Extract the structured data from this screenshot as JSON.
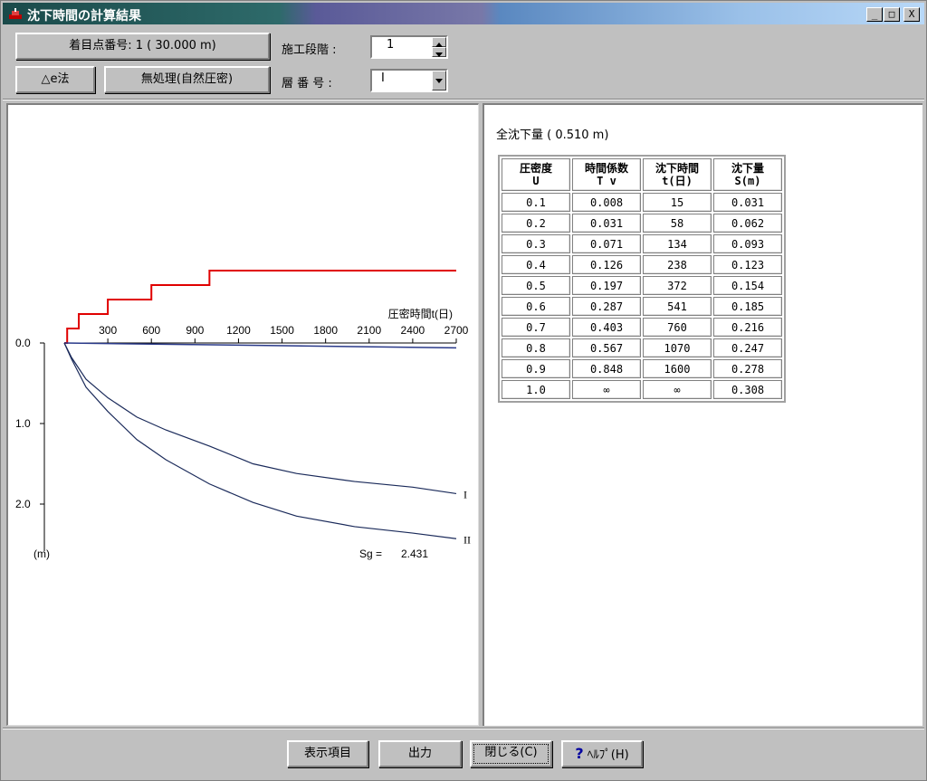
{
  "window": {
    "title": "沈下時間の計算結果",
    "minimize": "_",
    "maximize": "□",
    "close": "X"
  },
  "header": {
    "point_button": "着目点番号: 1 ( 30.000 m)",
    "method_button": "△e法",
    "treatment_button": "無処理(自然圧密)",
    "stage_label": "施工段階 :",
    "stage_value": "1",
    "layer_label": "層 番 号 :",
    "layer_value": "I"
  },
  "chart_data": {
    "type": "line",
    "xlabel": "圧密時間t(日)",
    "ylabel": "(m)",
    "xlim": [
      0,
      2700
    ],
    "ylim": [
      0,
      2.5
    ],
    "x_ticks": [
      "300",
      "600",
      "900",
      "1200",
      "1500",
      "1800",
      "2100",
      "2400",
      "2700"
    ],
    "y_ticks": [
      "0.0",
      "1.0",
      "2.0"
    ],
    "series": [
      {
        "name": "I",
        "x": [
          0,
          50,
          150,
          300,
          500,
          700,
          1000,
          1300,
          1600,
          2000,
          2400,
          2700
        ],
        "y": [
          0,
          0.18,
          0.45,
          0.68,
          0.92,
          1.08,
          1.28,
          1.5,
          1.62,
          1.72,
          1.79,
          1.87
        ]
      },
      {
        "name": "II",
        "x": [
          0,
          50,
          150,
          300,
          500,
          700,
          1000,
          1300,
          1600,
          2000,
          2400,
          2700
        ],
        "y": [
          0,
          0.2,
          0.55,
          0.85,
          1.2,
          1.45,
          1.75,
          1.98,
          2.15,
          2.28,
          2.36,
          2.43
        ]
      }
    ],
    "top_line": {
      "x": [
        0,
        2700
      ],
      "y": [
        0,
        0.06
      ]
    },
    "load_steps": [
      {
        "t": 0,
        "level": 0
      },
      {
        "t": 20,
        "level": 1
      },
      {
        "t": 100,
        "level": 2
      },
      {
        "t": 300,
        "level": 3
      },
      {
        "t": 600,
        "level": 4
      },
      {
        "t": 1000,
        "level": 5
      },
      {
        "t": 2700,
        "level": 5
      }
    ],
    "sg_label": "Sg =",
    "sg_value": "2.431"
  },
  "results": {
    "total_label": "全沈下量 ( 0.510 m)",
    "headers": [
      [
        "圧密度",
        "U"
      ],
      [
        "時間係数",
        "T v"
      ],
      [
        "沈下時間",
        "t(日)"
      ],
      [
        "沈下量",
        "S(m)"
      ]
    ],
    "rows": [
      [
        "0.1",
        "0.008",
        "15",
        "0.031"
      ],
      [
        "0.2",
        "0.031",
        "58",
        "0.062"
      ],
      [
        "0.3",
        "0.071",
        "134",
        "0.093"
      ],
      [
        "0.4",
        "0.126",
        "238",
        "0.123"
      ],
      [
        "0.5",
        "0.197",
        "372",
        "0.154"
      ],
      [
        "0.6",
        "0.287",
        "541",
        "0.185"
      ],
      [
        "0.7",
        "0.403",
        "760",
        "0.216"
      ],
      [
        "0.8",
        "0.567",
        "1070",
        "0.247"
      ],
      [
        "0.9",
        "0.848",
        "1600",
        "0.278"
      ],
      [
        "1.0",
        "∞",
        "∞",
        "0.308"
      ]
    ]
  },
  "footer": {
    "display_items": "表示項目",
    "output": "出力",
    "close": "閉じる(C)",
    "help": "ﾍﾙﾌﾟ(H)",
    "help_glyph": "?"
  },
  "colors": {
    "load_line": "#e00000",
    "curve": "#1a2a5a",
    "top_line": "#2a3a8a"
  }
}
